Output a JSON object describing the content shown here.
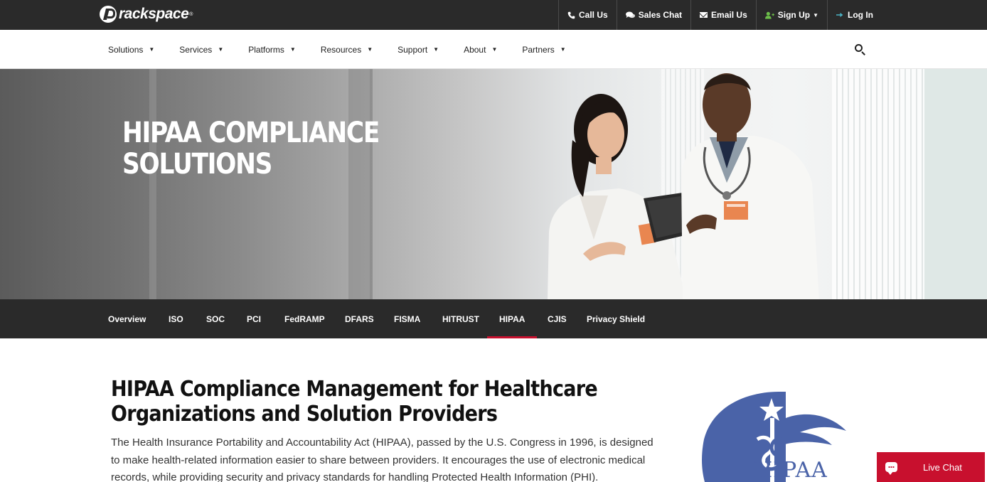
{
  "brand": {
    "logo_text": "rackspace",
    "trademark": "®"
  },
  "utility_nav": {
    "call": "Call Us",
    "chat": "Sales Chat",
    "email": "Email Us",
    "signup": "Sign Up",
    "login": "Log In"
  },
  "main_nav": {
    "items": [
      {
        "label": "Solutions"
      },
      {
        "label": "Services"
      },
      {
        "label": "Platforms"
      },
      {
        "label": "Resources"
      },
      {
        "label": "Support"
      },
      {
        "label": "About"
      },
      {
        "label": "Partners"
      }
    ]
  },
  "hero": {
    "title_line1": "HIPAA COMPLIANCE",
    "title_line2": "SOLUTIONS"
  },
  "compliance_tabs": {
    "active": "HIPAA",
    "items": [
      {
        "label": "Overview"
      },
      {
        "label": "ISO"
      },
      {
        "label": "SOC"
      },
      {
        "label": "PCI"
      },
      {
        "label": "FedRAMP"
      },
      {
        "label": "DFARS"
      },
      {
        "label": "FISMA"
      },
      {
        "label": "HITRUST"
      },
      {
        "label": "HIPAA"
      },
      {
        "label": "CJIS"
      },
      {
        "label": "Privacy Shield"
      }
    ]
  },
  "content": {
    "heading": "HIPAA Compliance Management for Healthcare Organizations and Solution Providers",
    "body": "The Health Insurance Portability and Accountability Act (HIPAA), passed by the U.S. Congress in 1996, is designed to make health-related information easier to share between providers. It encourages the use of electronic medical records, while providing security and privacy standards for handling Protected Health Information (PHI)."
  },
  "hipaa_logo": {
    "text": "HIPAA",
    "color": "#4a63a8"
  },
  "live_chat": {
    "label": "Live Chat"
  },
  "colors": {
    "dark_bar": "#2a2a2a",
    "accent_red": "#c8102e",
    "hipaa_blue": "#4a63a8"
  }
}
